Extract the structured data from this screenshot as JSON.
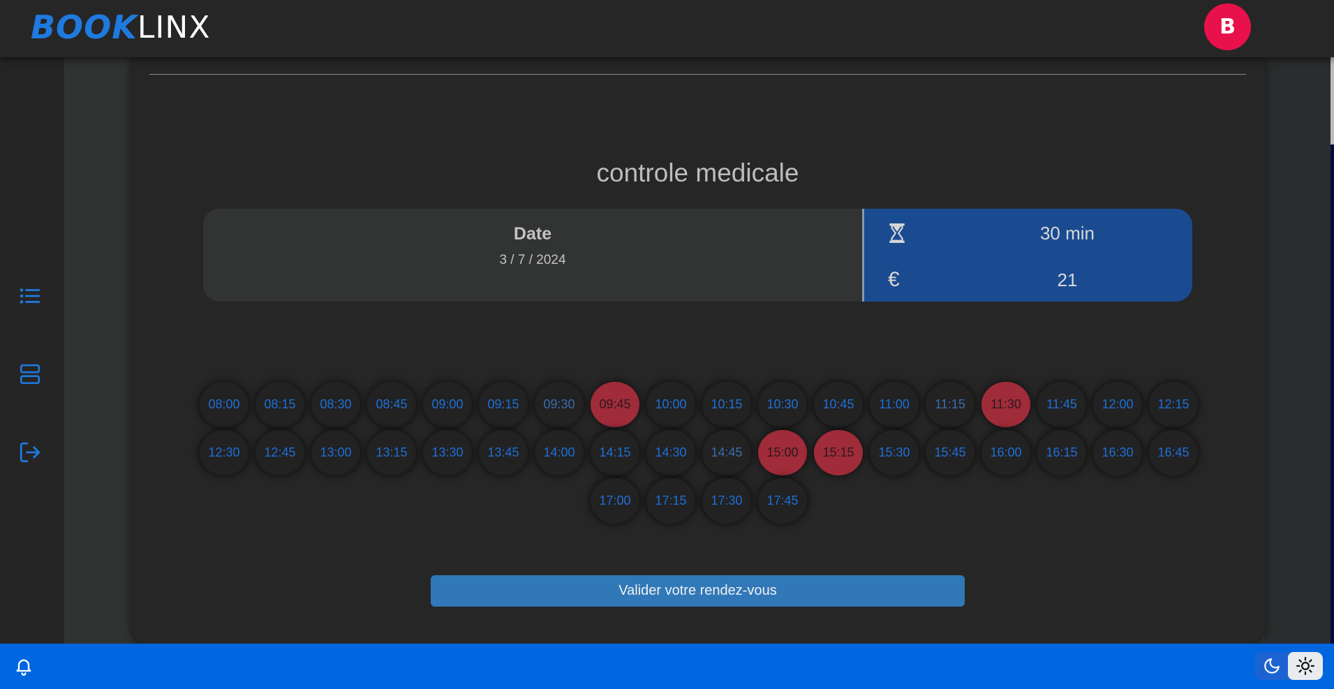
{
  "brand": {
    "part1": "BOOK",
    "part2": "LINX"
  },
  "user": {
    "avatar_initial": "B"
  },
  "service": {
    "title": "controle medicale",
    "date_label": "Date",
    "date_value": "3 / 7 / 2024",
    "duration": "30 min",
    "price": "21"
  },
  "icons": {
    "sidebar": [
      "list-icon",
      "server-rows-icon",
      "logout-icon"
    ],
    "duration": "hourglass-icon",
    "price": "euro-icon",
    "notifications": "bell-icon",
    "theme": [
      "moon-icon",
      "sun-icon"
    ]
  },
  "slots": [
    {
      "time": "08:00",
      "state": "available"
    },
    {
      "time": "08:15",
      "state": "available"
    },
    {
      "time": "08:30",
      "state": "available"
    },
    {
      "time": "08:45",
      "state": "available"
    },
    {
      "time": "09:00",
      "state": "available"
    },
    {
      "time": "09:15",
      "state": "available"
    },
    {
      "time": "09:30",
      "state": "dim"
    },
    {
      "time": "09:45",
      "state": "booked"
    },
    {
      "time": "10:00",
      "state": "available"
    },
    {
      "time": "10:15",
      "state": "available"
    },
    {
      "time": "10:30",
      "state": "available"
    },
    {
      "time": "10:45",
      "state": "available"
    },
    {
      "time": "11:00",
      "state": "available"
    },
    {
      "time": "11:15",
      "state": "dim"
    },
    {
      "time": "11:30",
      "state": "booked"
    },
    {
      "time": "11:45",
      "state": "available"
    },
    {
      "time": "12:00",
      "state": "available"
    },
    {
      "time": "12:15",
      "state": "available"
    },
    {
      "time": "12:30",
      "state": "available"
    },
    {
      "time": "12:45",
      "state": "available"
    },
    {
      "time": "13:00",
      "state": "available"
    },
    {
      "time": "13:15",
      "state": "available"
    },
    {
      "time": "13:30",
      "state": "available"
    },
    {
      "time": "13:45",
      "state": "available"
    },
    {
      "time": "14:00",
      "state": "available"
    },
    {
      "time": "14:15",
      "state": "available"
    },
    {
      "time": "14:30",
      "state": "available"
    },
    {
      "time": "14:45",
      "state": "dim"
    },
    {
      "time": "15:00",
      "state": "booked"
    },
    {
      "time": "15:15",
      "state": "booked"
    },
    {
      "time": "15:30",
      "state": "available"
    },
    {
      "time": "15:45",
      "state": "available"
    },
    {
      "time": "16:00",
      "state": "available"
    },
    {
      "time": "16:15",
      "state": "available"
    },
    {
      "time": "16:30",
      "state": "available"
    },
    {
      "time": "16:45",
      "state": "available"
    },
    {
      "time": "17:00",
      "state": "available"
    },
    {
      "time": "17:15",
      "state": "available"
    },
    {
      "time": "17:30",
      "state": "available"
    },
    {
      "time": "17:45",
      "state": "available"
    }
  ],
  "actions": {
    "validate_label": "Valider votre rendez-vous"
  },
  "colors": {
    "accent": "#1f7ae0",
    "booked": "#a02b39",
    "avatar": "#e8114b",
    "bottom_bar": "#0066e0",
    "info_panel": "#1a4b91"
  }
}
